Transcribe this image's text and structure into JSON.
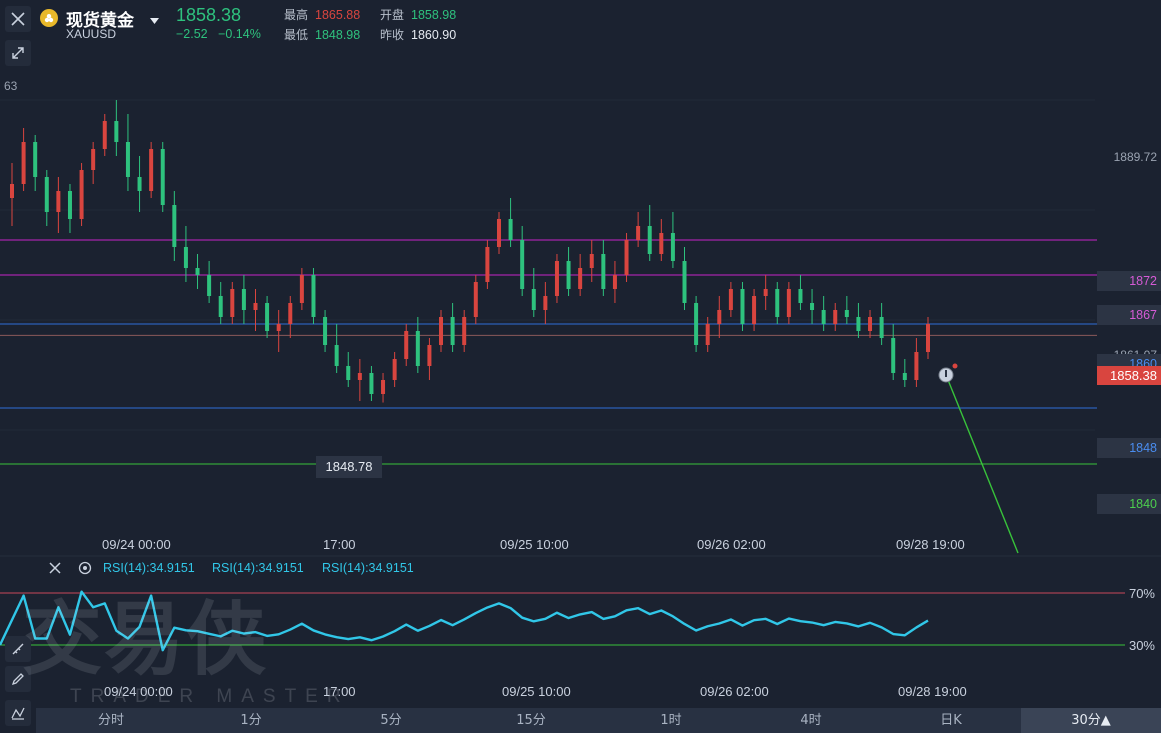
{
  "header": {
    "symbol_name": "现货黄金",
    "symbol_code": "XAUUSD",
    "last_price": "1858.38",
    "change": "−2.52",
    "change_pct": "−0.14%",
    "high_label": "最高",
    "high_value": "1865.88",
    "open_label": "开盘",
    "open_value": "1858.98",
    "low_label": "最低",
    "low_value": "1848.98",
    "prev_close_label": "昨收",
    "prev_close_value": "1860.90"
  },
  "colors": {
    "up": "#d9453f",
    "down": "#2ec27e",
    "magenta_line": "#c724c7",
    "blue_line": "#2f6fd8",
    "green_line": "#38c23a",
    "rsi_line": "#31c7e8",
    "overbought_line": "#c8485a",
    "oversold_line": "#38c23a"
  },
  "price_axis": {
    "top_partial": "63",
    "high_tick": "1889.72",
    "partial_tick": "1861.07",
    "current_price": "1858.38"
  },
  "levels": [
    {
      "label": "1872",
      "price": 1872,
      "color": "#c724c7"
    },
    {
      "label": "1867",
      "price": 1867,
      "color": "#c724c7"
    },
    {
      "label": "1860",
      "price": 1860,
      "color": "#2f6fd8"
    },
    {
      "label": "1848",
      "price": 1848,
      "color": "#2f6fd8"
    },
    {
      "label": "1840",
      "price": 1840,
      "color": "#38c23a"
    }
  ],
  "low_marker": "1848.78",
  "time_axis": [
    "09/24 00:00",
    "17:00",
    "09/25 10:00",
    "09/26 02:00",
    "09/28 19:00"
  ],
  "rsi": {
    "legend": [
      "RSI(14):34.9151",
      "RSI(14):34.9151",
      "RSI(14):34.9151"
    ],
    "overbought": "70%",
    "oversold": "30%",
    "time_axis": [
      "09/24 00:00",
      "17:00",
      "09/25 10:00",
      "09/26 02:00",
      "09/28 19:00"
    ]
  },
  "watermark": {
    "cn": "交易侠",
    "en": "TRADER MASTER"
  },
  "timeframes": [
    "分时",
    "1分",
    "5分",
    "15分",
    "1时",
    "4时",
    "日K",
    "30分▲"
  ],
  "active_timeframe_index": 7,
  "chart_data": {
    "type": "candlestick",
    "symbol": "XAUUSD",
    "interval": "30分",
    "ylim": [
      1832,
      1896
    ],
    "candles": [
      [
        1878,
        1883,
        1874,
        1880
      ],
      [
        1880,
        1888,
        1879,
        1886
      ],
      [
        1886,
        1887,
        1879,
        1881
      ],
      [
        1881,
        1882,
        1874,
        1876
      ],
      [
        1876,
        1881,
        1873,
        1879
      ],
      [
        1879,
        1880,
        1873,
        1875
      ],
      [
        1875,
        1883,
        1874,
        1882
      ],
      [
        1882,
        1886,
        1880,
        1885
      ],
      [
        1885,
        1890,
        1884,
        1889
      ],
      [
        1889,
        1892,
        1884,
        1886
      ],
      [
        1886,
        1890,
        1879,
        1881
      ],
      [
        1881,
        1884,
        1876,
        1879
      ],
      [
        1879,
        1886,
        1878,
        1885
      ],
      [
        1885,
        1886,
        1876,
        1877
      ],
      [
        1877,
        1879,
        1869,
        1871
      ],
      [
        1871,
        1874,
        1866,
        1868
      ],
      [
        1868,
        1870,
        1865,
        1867
      ],
      [
        1867,
        1869,
        1863,
        1864
      ],
      [
        1864,
        1866,
        1860,
        1861
      ],
      [
        1861,
        1866,
        1860,
        1865
      ],
      [
        1865,
        1867,
        1860,
        1862
      ],
      [
        1862,
        1865,
        1859,
        1863
      ],
      [
        1863,
        1864,
        1858,
        1859
      ],
      [
        1859,
        1862,
        1856,
        1860
      ],
      [
        1860,
        1864,
        1858,
        1863
      ],
      [
        1863,
        1868,
        1862,
        1867
      ],
      [
        1867,
        1868,
        1860,
        1861
      ],
      [
        1861,
        1862,
        1856,
        1857
      ],
      [
        1857,
        1860,
        1853,
        1854
      ],
      [
        1854,
        1856,
        1851,
        1852
      ],
      [
        1852,
        1855,
        1849,
        1853
      ],
      [
        1853,
        1854,
        1849,
        1850
      ],
      [
        1850,
        1853,
        1848.78,
        1852
      ],
      [
        1852,
        1856,
        1851,
        1855
      ],
      [
        1855,
        1860,
        1854,
        1859
      ],
      [
        1859,
        1861,
        1853,
        1854
      ],
      [
        1854,
        1858,
        1852,
        1857
      ],
      [
        1857,
        1862,
        1856,
        1861
      ],
      [
        1861,
        1863,
        1856,
        1857
      ],
      [
        1857,
        1862,
        1856,
        1861
      ],
      [
        1861,
        1867,
        1860,
        1866
      ],
      [
        1866,
        1872,
        1865,
        1871
      ],
      [
        1871,
        1876,
        1870,
        1875
      ],
      [
        1875,
        1878,
        1871,
        1872
      ],
      [
        1872,
        1874,
        1864,
        1865
      ],
      [
        1865,
        1868,
        1861,
        1862
      ],
      [
        1862,
        1866,
        1860,
        1864
      ],
      [
        1864,
        1870,
        1863,
        1869
      ],
      [
        1869,
        1871,
        1864,
        1865
      ],
      [
        1865,
        1870,
        1864,
        1868
      ],
      [
        1868,
        1872,
        1866,
        1870
      ],
      [
        1870,
        1872,
        1864,
        1865
      ],
      [
        1865,
        1869,
        1863,
        1867
      ],
      [
        1867,
        1873,
        1866,
        1872
      ],
      [
        1872,
        1876,
        1871,
        1874
      ],
      [
        1874,
        1877,
        1869,
        1870
      ],
      [
        1870,
        1875,
        1869,
        1873
      ],
      [
        1873,
        1876,
        1868,
        1869
      ],
      [
        1869,
        1871,
        1862,
        1863
      ],
      [
        1863,
        1864,
        1856,
        1857
      ],
      [
        1857,
        1861,
        1856,
        1860
      ],
      [
        1860,
        1864,
        1858,
        1862
      ],
      [
        1862,
        1866,
        1861,
        1865
      ],
      [
        1865,
        1866,
        1859,
        1860
      ],
      [
        1860,
        1865,
        1859,
        1864
      ],
      [
        1864,
        1867,
        1862,
        1865
      ],
      [
        1865,
        1866,
        1860,
        1861
      ],
      [
        1861,
        1866,
        1860,
        1865
      ],
      [
        1865,
        1867,
        1862,
        1863
      ],
      [
        1863,
        1865,
        1860,
        1862
      ],
      [
        1862,
        1864,
        1859,
        1860
      ],
      [
        1860,
        1863,
        1859,
        1862
      ],
      [
        1862,
        1864,
        1860,
        1861
      ],
      [
        1861,
        1863,
        1858,
        1859
      ],
      [
        1859,
        1862,
        1858,
        1861
      ],
      [
        1861,
        1863,
        1857,
        1858
      ],
      [
        1858,
        1860,
        1852,
        1853
      ],
      [
        1853,
        1855,
        1851,
        1852
      ],
      [
        1852,
        1858,
        1851,
        1856
      ],
      [
        1856,
        1861,
        1855,
        1860
      ]
    ]
  }
}
